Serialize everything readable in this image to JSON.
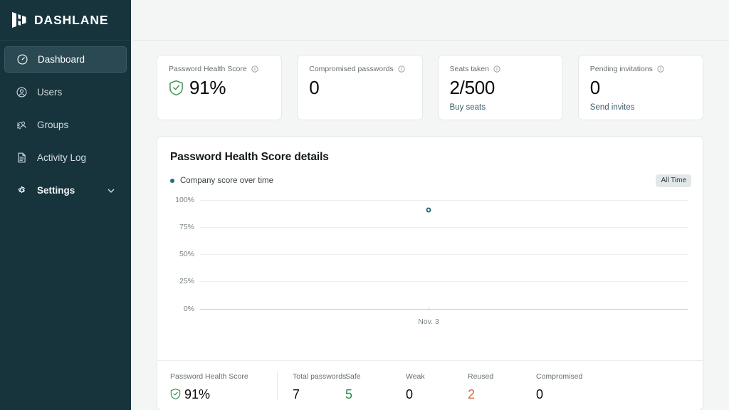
{
  "brand": {
    "name": "DASHLANE",
    "logo_icon": "dashlane-logo-mark",
    "bg_color": "#17343d"
  },
  "sidebar": {
    "items": [
      {
        "label": "Dashboard",
        "icon": "speedometer-icon",
        "active": true
      },
      {
        "label": "Users",
        "icon": "user-circle-icon",
        "active": false
      },
      {
        "label": "Groups",
        "icon": "people-group-icon",
        "active": false
      },
      {
        "label": "Activity Log",
        "icon": "document-icon",
        "active": false
      },
      {
        "label": "Settings",
        "icon": "gear-icon",
        "active": false,
        "chevron": "chevron-down-icon"
      }
    ]
  },
  "kpis": [
    {
      "title": "Password Health Score",
      "value": "91%",
      "icon": "shield-check-icon",
      "info": "info-icon",
      "link": ""
    },
    {
      "title": "Compromised passwords",
      "value": "0",
      "icon": "",
      "info": "info-icon",
      "link": ""
    },
    {
      "title": "Seats taken",
      "value": "2/500",
      "icon": "",
      "info": "info-icon",
      "link": "Buy seats"
    },
    {
      "title": "Pending invitations",
      "value": "0",
      "icon": "",
      "info": "info-icon",
      "link": "Send invites"
    }
  ],
  "details": {
    "title": "Password Health Score details",
    "legend_label": "Company score over time",
    "range_label": "All Time",
    "accent_color": "#2c6b78"
  },
  "chart_data": {
    "type": "scatter",
    "title": "Password Health Score details",
    "series": [
      {
        "name": "Company score over time",
        "color": "#2c6b78",
        "x": [
          "Nov. 3"
        ],
        "values": [
          91
        ]
      }
    ],
    "categories": [
      "Nov. 3"
    ],
    "xlabel": "",
    "ylabel": "",
    "ylim": [
      0,
      100
    ],
    "yticks": [
      100,
      75,
      50,
      25,
      0
    ],
    "ytick_labels": [
      "100%",
      "75%",
      "50%",
      "25%",
      "0%"
    ],
    "xtick_labels": [
      "Nov. 3"
    ],
    "grid": true,
    "legend_position": "top-left"
  },
  "stats": [
    {
      "label": "Password Health Score",
      "value": "91%",
      "icon": "shield-check-icon",
      "color": "#0a0a0a"
    },
    {
      "label": "Total passwords",
      "value": "7",
      "icon": "",
      "color": "#0a0a0a"
    },
    {
      "label": "Safe",
      "value": "5",
      "icon": "",
      "color": "#2a8a4a"
    },
    {
      "label": "Weak",
      "value": "0",
      "icon": "",
      "color": "#0a0a0a"
    },
    {
      "label": "Reused",
      "value": "2",
      "icon": "",
      "color": "#dd6640"
    },
    {
      "label": "Compromised",
      "value": "0",
      "icon": "",
      "color": "#0a0a0a"
    }
  ]
}
